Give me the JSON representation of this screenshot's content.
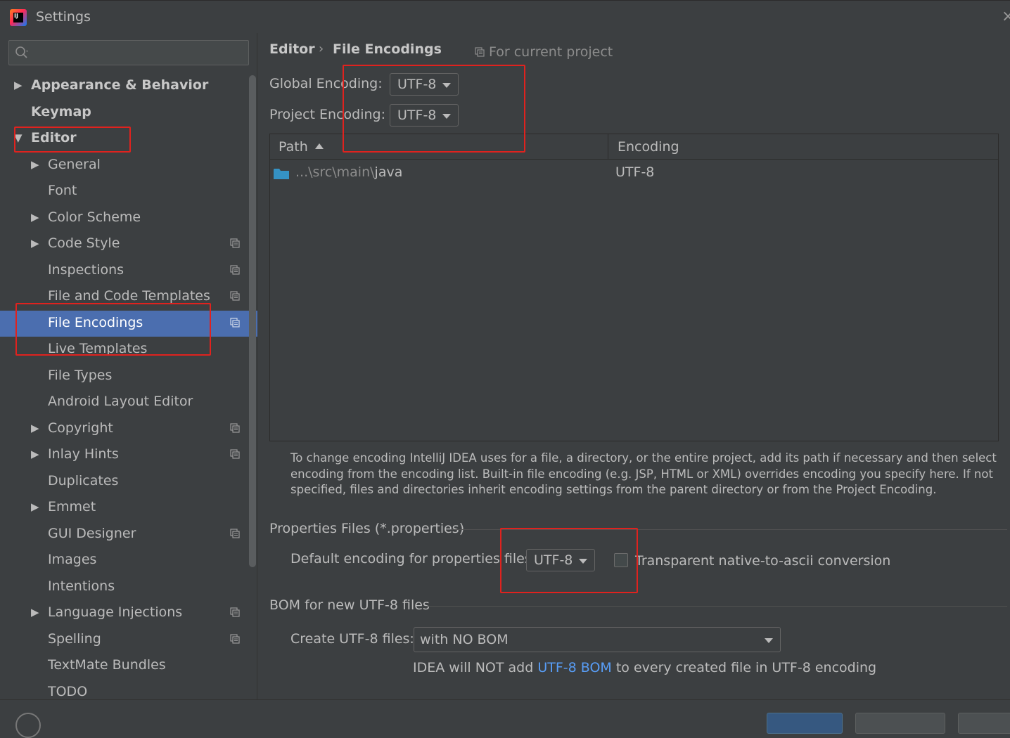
{
  "window": {
    "title": "Settings"
  },
  "search": {
    "placeholder": ""
  },
  "sidebar": {
    "items": [
      {
        "label": "Appearance & Behavior",
        "arrow": "▶"
      },
      {
        "label": "Keymap",
        "arrow": ""
      },
      {
        "label": "Editor",
        "arrow": "▼"
      },
      {
        "label": "General",
        "arrow": "▶"
      },
      {
        "label": "Font",
        "arrow": ""
      },
      {
        "label": "Color Scheme",
        "arrow": "▶"
      },
      {
        "label": "Code Style",
        "arrow": "▶"
      },
      {
        "label": "Inspections",
        "arrow": ""
      },
      {
        "label": "File and Code Templates",
        "arrow": ""
      },
      {
        "label": "File Encodings",
        "arrow": ""
      },
      {
        "label": "Live Templates",
        "arrow": ""
      },
      {
        "label": "File Types",
        "arrow": ""
      },
      {
        "label": "Android Layout Editor",
        "arrow": ""
      },
      {
        "label": "Copyright",
        "arrow": "▶"
      },
      {
        "label": "Inlay Hints",
        "arrow": "▶"
      },
      {
        "label": "Duplicates",
        "arrow": ""
      },
      {
        "label": "Emmet",
        "arrow": "▶"
      },
      {
        "label": "GUI Designer",
        "arrow": ""
      },
      {
        "label": "Images",
        "arrow": ""
      },
      {
        "label": "Intentions",
        "arrow": ""
      },
      {
        "label": "Language Injections",
        "arrow": "▶"
      },
      {
        "label": "Spelling",
        "arrow": ""
      },
      {
        "label": "TextMate Bundles",
        "arrow": ""
      },
      {
        "label": "TODO",
        "arrow": ""
      }
    ]
  },
  "breadcrumb": {
    "parent": "Editor",
    "separator": "›",
    "current": "File Encodings",
    "scope": "For current project"
  },
  "encodings": {
    "global_label": "Global Encoding:",
    "global_value": "UTF-8",
    "project_label": "Project Encoding:",
    "project_value": "UTF-8"
  },
  "table": {
    "columns": [
      "Path",
      "Encoding"
    ],
    "rows": [
      {
        "path_prefix": "...\\src\\main\\",
        "path_name": "java",
        "encoding": "UTF-8"
      }
    ]
  },
  "help_text": "To change encoding IntelliJ IDEA uses for a file, a directory, or the entire project, add its path if necessary and then select encoding from the encoding list. Built-in file encoding (e.g. JSP, HTML or XML) overrides encoding you specify here. If not specified, files and directories inherit encoding settings from the parent directory or from the Project Encoding.",
  "properties": {
    "section_title": "Properties Files (*.properties)",
    "default_label": "Default encoding for properties files:",
    "default_value": "UTF-8",
    "native_ascii_label": "Transparent native-to-ascii conversion",
    "native_ascii_checked": false
  },
  "bom": {
    "section_title": "BOM for new UTF-8 files",
    "create_label": "Create UTF-8 files:",
    "create_value": "with NO BOM",
    "note_before": "IDEA will NOT add ",
    "note_link": "UTF-8 BOM",
    "note_after": " to every created file in UTF-8 encoding"
  },
  "colors": {
    "background": "#3c3f41",
    "selection": "#4b6eaf",
    "link": "#589df6",
    "annotation": "#e0221e"
  },
  "icons": [
    "app-logo-icon",
    "search-icon",
    "expand-arrow-icon",
    "project-scope-icon",
    "folder-icon",
    "sort-ascending-icon",
    "dropdown-caret-icon"
  ]
}
